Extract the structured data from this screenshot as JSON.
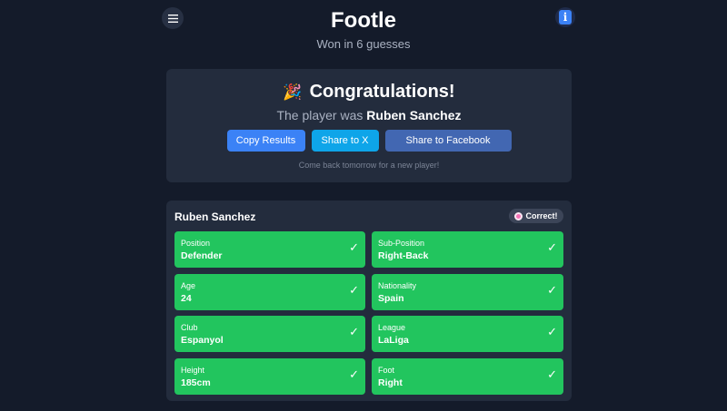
{
  "header": {
    "title": "Footle",
    "subtitle": "Won in 6 guesses",
    "menu_icon": "hamburger-menu-icon",
    "info_icon": "info-icon",
    "info_glyph": "i"
  },
  "congrats": {
    "emoji": "🎉",
    "heading": "Congratulations!",
    "player_prefix": "The player was",
    "player_name": "Ruben Sanchez",
    "buttons": {
      "copy": "Copy Results",
      "share_x": "Share to X",
      "share_facebook": "Share to Facebook"
    },
    "footer_note": "Come back tomorrow for a new player!"
  },
  "guess": {
    "name": "Ruben Sanchez",
    "status_icon": "target-icon",
    "status": "Correct!",
    "check_mark": "✓",
    "attributes": [
      {
        "label": "Position",
        "value": "Defender"
      },
      {
        "label": "Sub-Position",
        "value": "Right-Back"
      },
      {
        "label": "Age",
        "value": "24"
      },
      {
        "label": "Nationality",
        "value": "Spain"
      },
      {
        "label": "Club",
        "value": "Espanyol"
      },
      {
        "label": "League",
        "value": "LaLiga"
      },
      {
        "label": "Height",
        "value": "185cm"
      },
      {
        "label": "Foot",
        "value": "Right"
      }
    ]
  },
  "colors": {
    "background": "#141b2a",
    "card": "#232c3d",
    "correct": "#22c55e",
    "primary_button": "#3b82f6",
    "x_button": "#0ea5e9",
    "facebook_button": "#4267b2"
  }
}
